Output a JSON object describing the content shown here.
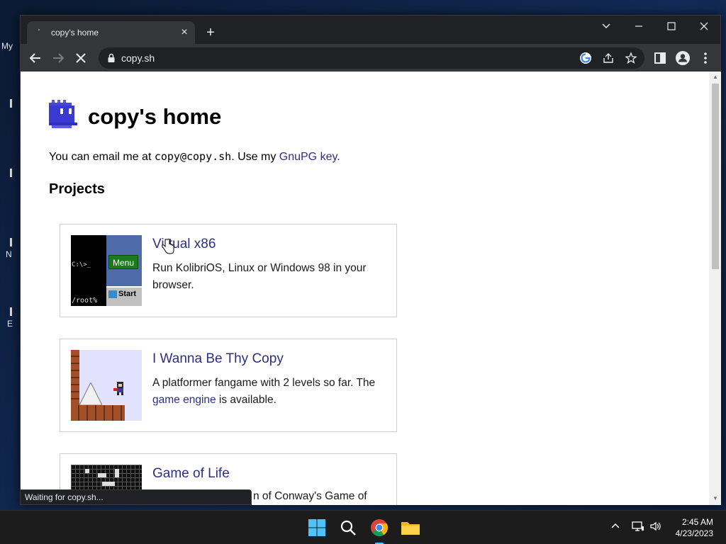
{
  "desktop": {
    "icon_labels": [
      "My",
      "N",
      "E"
    ]
  },
  "browser": {
    "tab_title": "copy's home",
    "url": "copy.sh",
    "status_text": "Waiting for copy.sh..."
  },
  "page": {
    "heading": "copy's home",
    "email_prefix": "You can email me at ",
    "email": "copy@copy.sh",
    "email_mid": ". Use my ",
    "gpg_link": "GnuPG key",
    "email_suffix": ".",
    "projects_heading": "Projects",
    "cards": [
      {
        "title": "Virtual x86",
        "desc": "Run KolibriOS, Linux or Windows 98 in your browser.",
        "thumb_text": {
          "prompt": "C:\\>_",
          "root": "/root%",
          "menu": "Menu",
          "start": "Start"
        }
      },
      {
        "title": "I Wanna Be Thy Copy",
        "desc_prefix": "A platformer fangame with 2 levels so far. The ",
        "desc_link": "game engine",
        "desc_suffix": " is available."
      },
      {
        "title": "Game of Life",
        "desc": "n of Conway's Game of"
      }
    ]
  },
  "taskbar": {
    "time": "2:45 AM",
    "date": "4/23/2023"
  },
  "colors": {
    "link": "#2e2e84",
    "chrome_dark": "#202124",
    "chrome_tab": "#35363a",
    "taskbar": "#1c1c1c"
  }
}
